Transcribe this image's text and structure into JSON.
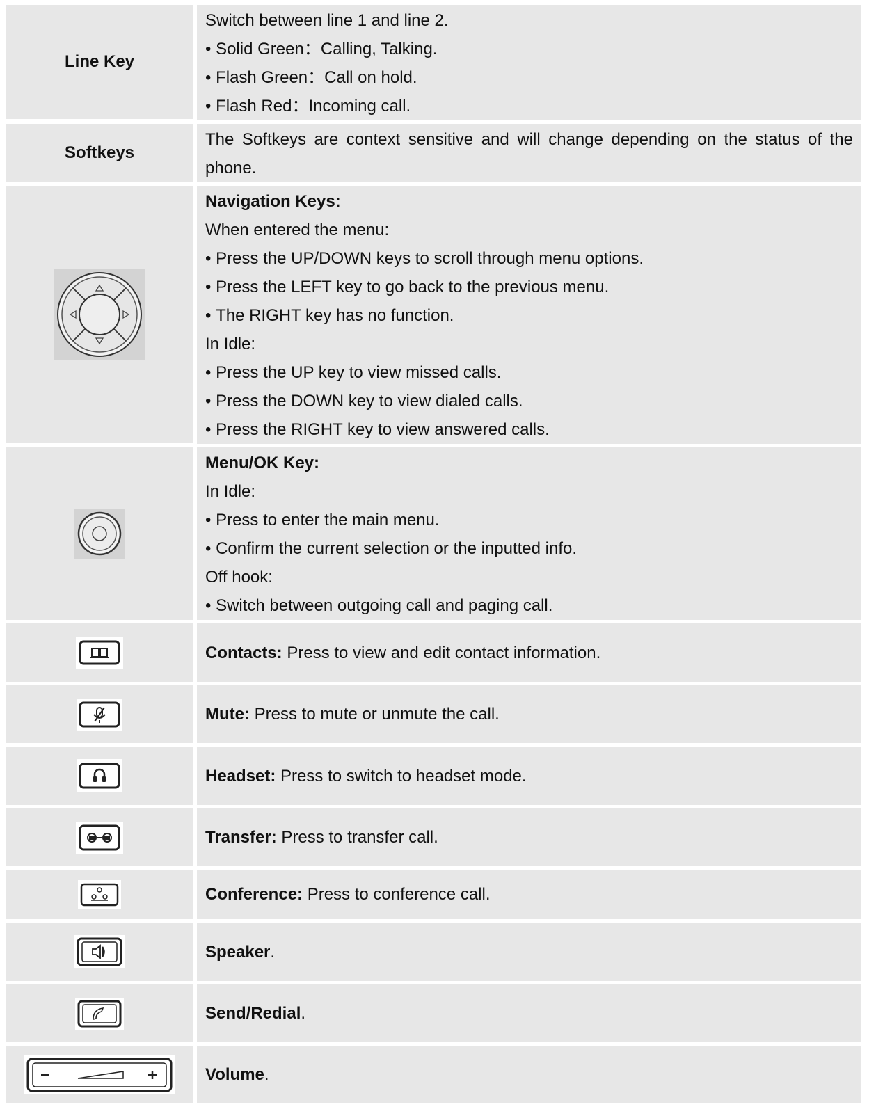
{
  "rows": [
    {
      "key": "Line Key",
      "lines": [
        {
          "text": "Switch between line 1 and line 2.",
          "bullet": false
        },
        {
          "text": "Solid Green：Calling, Talking.",
          "bullet": true
        },
        {
          "text": "Flash Green：Call on hold.",
          "bullet": true
        },
        {
          "text": "Flash Red：Incoming call.",
          "bullet": true
        }
      ]
    },
    {
      "key": "Softkeys",
      "text": "The Softkeys are context sensitive and will change depending on the status of the phone."
    },
    {
      "icon": "navigation-pad-icon",
      "title": "Navigation Keys:",
      "lines": [
        {
          "text": "When entered the menu:",
          "bullet": false
        },
        {
          "text": "Press the UP/DOWN keys to scroll through menu options.",
          "bullet": true
        },
        {
          "text": "Press the LEFT key to go back to the previous menu.",
          "bullet": true
        },
        {
          "text": "The RIGHT key has no function.",
          "bullet": true
        },
        {
          "text": "In Idle:",
          "bullet": false
        },
        {
          "text": "Press the UP key to view missed calls.",
          "bullet": true
        },
        {
          "text": "Press the DOWN key to view dialed calls.",
          "bullet": true
        },
        {
          "text": "Press the RIGHT key to view answered calls.",
          "bullet": true
        }
      ]
    },
    {
      "icon": "menu-ok-key-icon",
      "title": "Menu/OK Key:",
      "lines": [
        {
          "text": "In Idle:",
          "bullet": false
        },
        {
          "text": "Press to enter the main menu.",
          "bullet": true
        },
        {
          "text": "Confirm the current selection or the inputted info.",
          "bullet": true
        },
        {
          "text": "Off hook:",
          "bullet": false
        },
        {
          "text": "Switch between outgoing call and paging call.",
          "bullet": true
        }
      ]
    },
    {
      "icon": "contacts-book-icon",
      "label": "Contacts:",
      "desc": " Press to view and edit contact information."
    },
    {
      "icon": "mute-microphone-icon",
      "label": "Mute:",
      "desc": " Press to mute or unmute the call."
    },
    {
      "icon": "headset-icon",
      "label": "Headset:",
      "desc": " Press to switch to headset mode."
    },
    {
      "icon": "transfer-icon",
      "label": "Transfer:",
      "desc": " Press to transfer call."
    },
    {
      "icon": "conference-icon",
      "label": "Conference:",
      "desc": " Press to conference call."
    },
    {
      "icon": "speaker-icon",
      "label": "Speaker",
      "desc": "."
    },
    {
      "icon": "send-redial-handset-icon",
      "label": "Send/Redial",
      "desc": "."
    },
    {
      "icon": "volume-rocker-icon",
      "label": "Volume",
      "desc": "."
    }
  ]
}
